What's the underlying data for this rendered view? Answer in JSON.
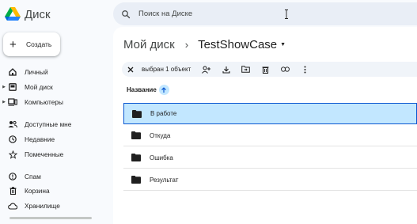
{
  "app": {
    "name": "Диск"
  },
  "search": {
    "placeholder": "Поиск на Диске"
  },
  "create_button": {
    "label": "Создать"
  },
  "sidebar": {
    "items": [
      {
        "label": "Личный",
        "icon": "home-icon",
        "expandable": false
      },
      {
        "label": "Мой диск",
        "icon": "drive-icon",
        "expandable": true
      },
      {
        "label": "Компьютеры",
        "icon": "computer-icon",
        "expandable": true
      },
      {
        "label": "Доступные мне",
        "icon": "shared-icon",
        "expandable": false
      },
      {
        "label": "Недавние",
        "icon": "clock-icon",
        "expandable": false
      },
      {
        "label": "Помеченные",
        "icon": "star-icon",
        "expandable": false
      },
      {
        "label": "Спам",
        "icon": "spam-icon",
        "expandable": false
      },
      {
        "label": "Корзина",
        "icon": "trash-icon",
        "expandable": false
      },
      {
        "label": "Хранилище",
        "icon": "cloud-icon",
        "expandable": false
      }
    ]
  },
  "breadcrumb": {
    "root": "Мой диск",
    "separator": "›",
    "current": "TestShowCase"
  },
  "selection_bar": {
    "count_label": "выбран 1 объект",
    "actions": [
      "share-icon",
      "download-icon",
      "move-icon",
      "delete-icon",
      "link-icon",
      "more-icon"
    ]
  },
  "file_list": {
    "column_header": "Название",
    "sort": "ascending",
    "rows": [
      {
        "name": "В работе",
        "selected": true
      },
      {
        "name": "Откуда",
        "selected": false
      },
      {
        "name": "Ошибка",
        "selected": false
      },
      {
        "name": "Результат",
        "selected": false
      }
    ]
  },
  "colors": {
    "accent": "#0b57d0",
    "selected_bg": "#c2e7ff",
    "sidebar_bg": "#f8fafd",
    "search_bg": "#e9eef6"
  }
}
